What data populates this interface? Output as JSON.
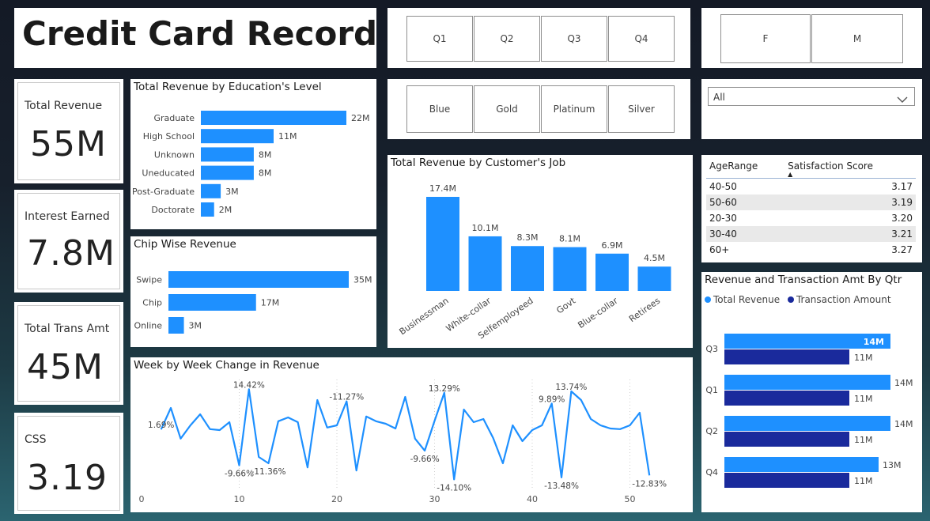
{
  "title": "Credit Card Record",
  "colors": {
    "bar": "#1e90ff",
    "bar_dark": "#1a2a9c",
    "line": "#1e90ff"
  },
  "kpis": [
    {
      "label": "Total Revenue",
      "value": "55M"
    },
    {
      "label": "Interest Earned",
      "value": "7.8M"
    },
    {
      "label": "Total Trans Amt",
      "value": "45M"
    },
    {
      "label": "CSS",
      "value": "3.19"
    }
  ],
  "quarter_slicer": [
    "Q1",
    "Q2",
    "Q3",
    "Q4"
  ],
  "gender_slicer": [
    "F",
    "M"
  ],
  "card_slicer": [
    "Blue",
    "Gold",
    "Platinum",
    "Silver"
  ],
  "dropdown": {
    "value": "All",
    "icon": "chevron-down-icon"
  },
  "satisfaction_table": {
    "headers": [
      "AgeRange",
      "Satisfaction Score"
    ],
    "rows": [
      [
        "40-50",
        "3.17"
      ],
      [
        "50-60",
        "3.19"
      ],
      [
        "20-30",
        "3.20"
      ],
      [
        "30-40",
        "3.21"
      ],
      [
        "60+",
        "3.27"
      ]
    ]
  },
  "visual_titles": {
    "education": "Total Revenue by Education's Level",
    "chip": "Chip Wise Revenue",
    "job": "Total Revenue by Customer's Job",
    "weekly": "Week by Week Change in Revenue",
    "quarter": "Revenue and Transaction Amt By Qtr"
  },
  "chart_data": [
    {
      "id": "education",
      "type": "bar",
      "orientation": "horizontal",
      "title": "Total Revenue by Education's Level",
      "categories": [
        "Graduate",
        "High School",
        "Unknown",
        "Uneducated",
        "Post-Graduate",
        "Doctorate"
      ],
      "values": [
        22,
        11,
        8,
        8,
        3,
        2
      ],
      "data_labels": [
        "22M",
        "11M",
        "8M",
        "8M",
        "3M",
        "2M"
      ],
      "unit": "M",
      "xlim": [
        0,
        22
      ]
    },
    {
      "id": "chip",
      "type": "bar",
      "orientation": "horizontal",
      "title": "Chip Wise Revenue",
      "categories": [
        "Swipe",
        "Chip",
        "Online"
      ],
      "values": [
        35,
        17,
        3
      ],
      "data_labels": [
        "35M",
        "17M",
        "3M"
      ],
      "unit": "M",
      "xlim": [
        0,
        35
      ]
    },
    {
      "id": "job",
      "type": "bar",
      "orientation": "vertical",
      "title": "Total Revenue by Customer's Job",
      "categories": [
        "Businessman",
        "White-collar",
        "Selfemployeed",
        "Govt",
        "Blue-collar",
        "Retirees"
      ],
      "values": [
        17.4,
        10.1,
        8.3,
        8.1,
        6.9,
        4.5
      ],
      "data_labels": [
        "17.4M",
        "10.1M",
        "8.3M",
        "8.1M",
        "6.9M",
        "4.5M"
      ],
      "unit": "M",
      "ylim": [
        0,
        17.4
      ]
    },
    {
      "id": "weekly",
      "type": "line",
      "title": "Week by Week Change in Revenue",
      "x": [
        2,
        3,
        4,
        5,
        6,
        7,
        8,
        9,
        10,
        11,
        12,
        13,
        14,
        15,
        16,
        17,
        18,
        19,
        20,
        21,
        22,
        23,
        24,
        25,
        26,
        27,
        28,
        29,
        30,
        31,
        32,
        33,
        34,
        35,
        36,
        37,
        38,
        39,
        40,
        41,
        42,
        43,
        44,
        45,
        46,
        47,
        48,
        49,
        50,
        51,
        52
      ],
      "y": [
        1.69,
        8.5,
        -1.2,
        3.0,
        6.5,
        1.8,
        1.5,
        4.0,
        -9.66,
        14.42,
        -7.0,
        -9.0,
        4.3,
        5.5,
        4.0,
        -10.3,
        11.0,
        2.3,
        3.0,
        10.6,
        -11.27,
        5.8,
        4.3,
        3.5,
        2.0,
        12.0,
        -1.2,
        -5.0,
        4.4,
        13.29,
        -14.1,
        8.0,
        4.0,
        5.0,
        -1.0,
        -9.0,
        3.0,
        -2.0,
        1.5,
        3.0,
        9.89,
        -13.48,
        13.74,
        11.0,
        5.0,
        3.0,
        2.0,
        1.8,
        3.0,
        7.0,
        -12.83
      ],
      "point_labels": [
        {
          "x": 2,
          "label": "1.69%"
        },
        {
          "x": 10,
          "label": "-9.66%"
        },
        {
          "x": 11,
          "label": "14.42%"
        },
        {
          "x": 13,
          "label": "-11.36%"
        },
        {
          "x": 21,
          "label": "-11.27%"
        },
        {
          "x": 29,
          "label": "-9.66%"
        },
        {
          "x": 31,
          "label": "13.29%"
        },
        {
          "x": 32,
          "label": "-14.10%"
        },
        {
          "x": 42,
          "label": "9.89%"
        },
        {
          "x": 43,
          "label": "-13.48%"
        },
        {
          "x": 44,
          "label": "13.74%"
        },
        {
          "x": 52,
          "label": "-12.83%"
        }
      ],
      "xticks": [
        0,
        10,
        20,
        30,
        40,
        50
      ],
      "xlim": [
        0,
        56
      ],
      "ylim": [
        -16,
        17
      ],
      "grid": "vertical dotted"
    },
    {
      "id": "quarter",
      "type": "bar",
      "orientation": "horizontal",
      "title": "Revenue and Transaction Amt By Qtr",
      "categories": [
        "Q3",
        "Q1",
        "Q2",
        "Q4"
      ],
      "series": [
        {
          "name": "Total Revenue",
          "values": [
            14,
            14,
            14,
            13
          ],
          "data_labels": [
            "14M",
            "14M",
            "14M",
            "13M"
          ]
        },
        {
          "name": "Transaction Amount",
          "values": [
            11,
            11,
            11,
            11
          ],
          "data_labels": [
            "11M",
            "11M",
            "11M",
            "11M"
          ]
        }
      ],
      "unit": "M",
      "legend": "top-left"
    }
  ]
}
